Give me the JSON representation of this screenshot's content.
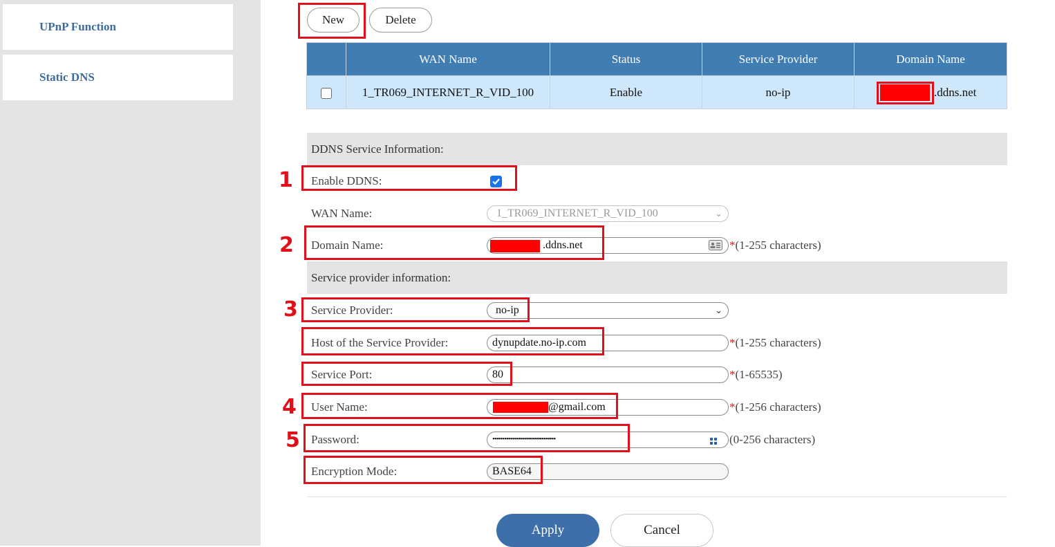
{
  "sidebar": {
    "items": [
      {
        "label": "UPnP Function"
      },
      {
        "label": "Static DNS"
      }
    ]
  },
  "toolbar": {
    "new_label": "New",
    "delete_label": "Delete"
  },
  "wan_table": {
    "headers": [
      "WAN Name",
      "Status",
      "Service Provider",
      "Domain Name"
    ],
    "rows": [
      {
        "wan_name": "1_TR069_INTERNET_R_VID_100",
        "status": "Enable",
        "provider": "no-ip",
        "domain_suffix": ".ddns.net"
      }
    ]
  },
  "ddns_section": {
    "title": "DDNS Service Information:"
  },
  "form": {
    "enable_ddns": {
      "label": "Enable DDNS:",
      "checked": true
    },
    "wan_name": {
      "label": "WAN Name:",
      "value": "1_TR069_INTERNET_R_VID_100"
    },
    "domain_name": {
      "label": "Domain Name:",
      "value_suffix": ".ddns.net",
      "hint_star": "*",
      "hint": "(1-255 characters)"
    },
    "provider_section_title": "Service provider information:",
    "service_provider": {
      "label": "Service Provider:",
      "value": "no-ip"
    },
    "host": {
      "label": "Host of the Service Provider:",
      "value": "dynupdate.no-ip.com",
      "hint_star": "*",
      "hint": "(1-255 characters)"
    },
    "port": {
      "label": "Service Port:",
      "value": "80",
      "hint_star": "*",
      "hint": "(1-65535)"
    },
    "username": {
      "label": "User Name:",
      "value_suffix": "@gmail.com",
      "hint_star": "*",
      "hint": "(1-256 characters)"
    },
    "password": {
      "label": "Password:",
      "value": "••••••••••••••••••••••••••••••••",
      "hint": "(0-256 characters)"
    },
    "encryption": {
      "label": "Encryption Mode:",
      "value": "BASE64"
    }
  },
  "actions": {
    "apply_label": "Apply",
    "cancel_label": "Cancel"
  },
  "annotations": [
    "1",
    "2",
    "3",
    "4",
    "5"
  ],
  "colors": {
    "accent": "#3f7db3",
    "annotation": "#e0101a",
    "sidebar_text": "#3d6b9e",
    "row_bg": "#cfe7fb"
  }
}
